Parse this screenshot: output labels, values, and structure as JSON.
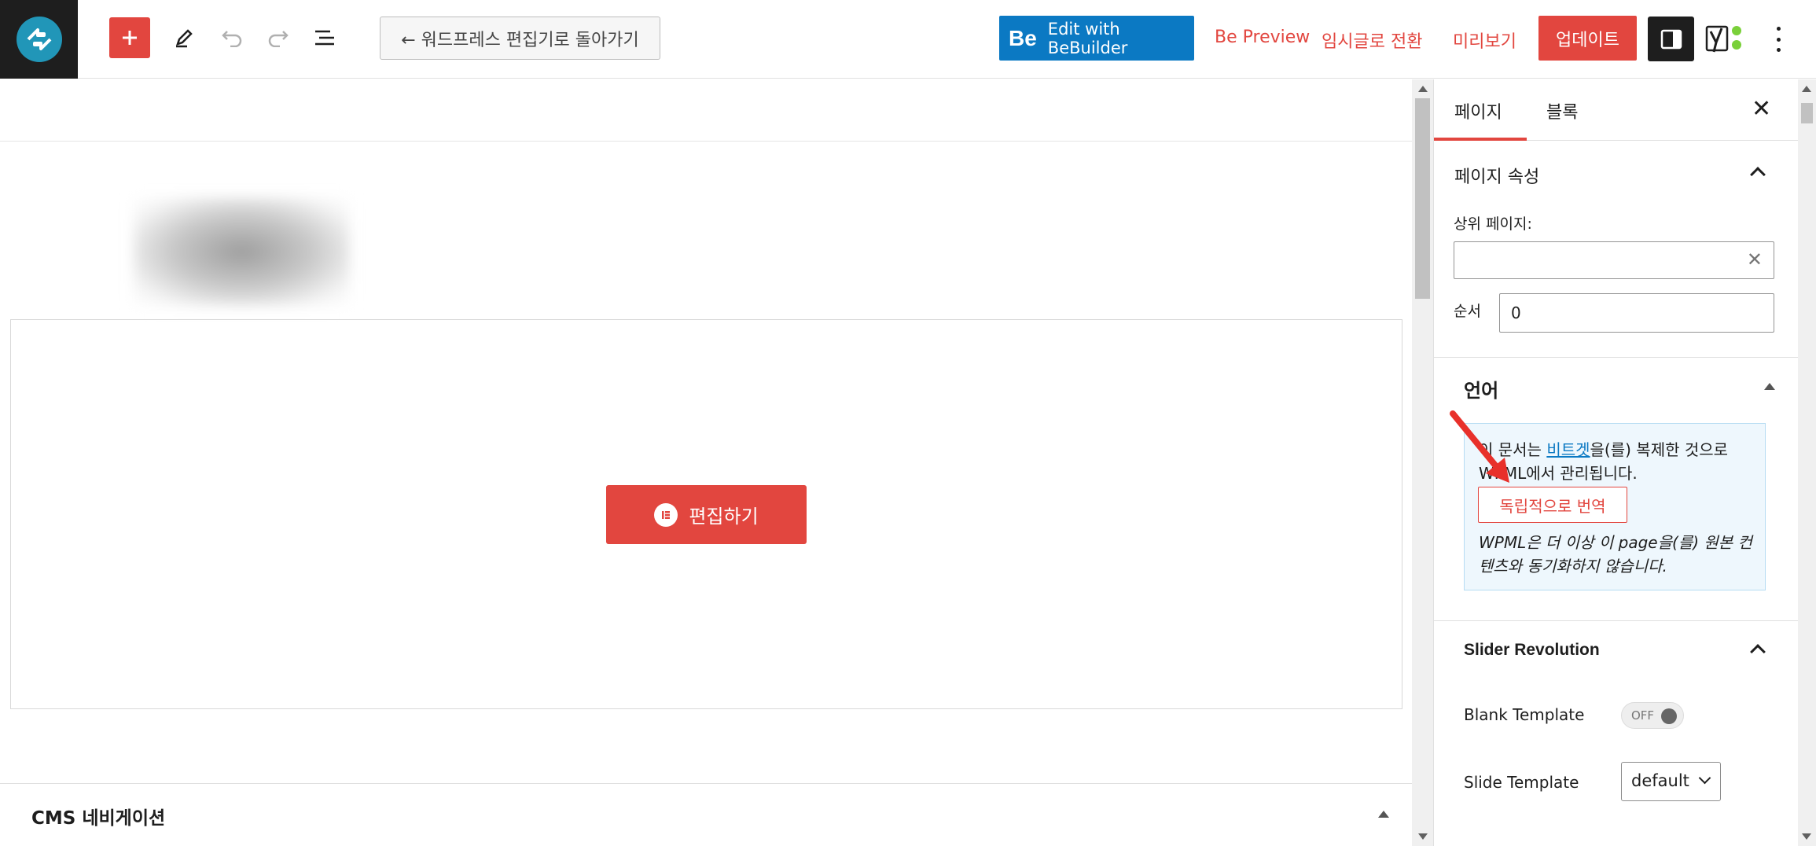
{
  "toolbar": {
    "back_label": "← 워드프레스 편집기로 돌아가기",
    "bebuilder_icon_text": "Be",
    "bebuilder_label": "Edit with BeBuilder",
    "be_preview": "Be Preview",
    "switch_draft": "임시글로 전환",
    "preview": "미리보기",
    "update": "업데이트"
  },
  "canvas": {
    "edit_button": "편집하기",
    "cms_title": "CMS 네비게이션"
  },
  "sidebar": {
    "tabs": [
      "페이지",
      "블록"
    ],
    "page_attributes": {
      "title": "페이지 속성",
      "parent_label": "상위 페이지:",
      "parent_value": "",
      "order_label": "순서",
      "order_value": "0"
    },
    "language": {
      "title": "언어",
      "text_before": "이 문서는 ",
      "link": "비트겟",
      "text_after": "을(를) 복제한 것으로 WPML에서 관리됩니다.",
      "translate_button": "독립적으로 번역",
      "note": "WPML은 더 이상 이 page을(를) 원본 컨텐츠와 동기화하지 않습니다."
    },
    "slider_revolution": {
      "title": "Slider Revolution",
      "blank_template_label": "Blank Template",
      "blank_template_state": "OFF",
      "slide_template_label": "Slide Template",
      "slide_template_value": "default"
    }
  },
  "colors": {
    "accent": "#e2463f",
    "bebuilder": "#0b79c3",
    "dark": "#1e1e1e"
  }
}
